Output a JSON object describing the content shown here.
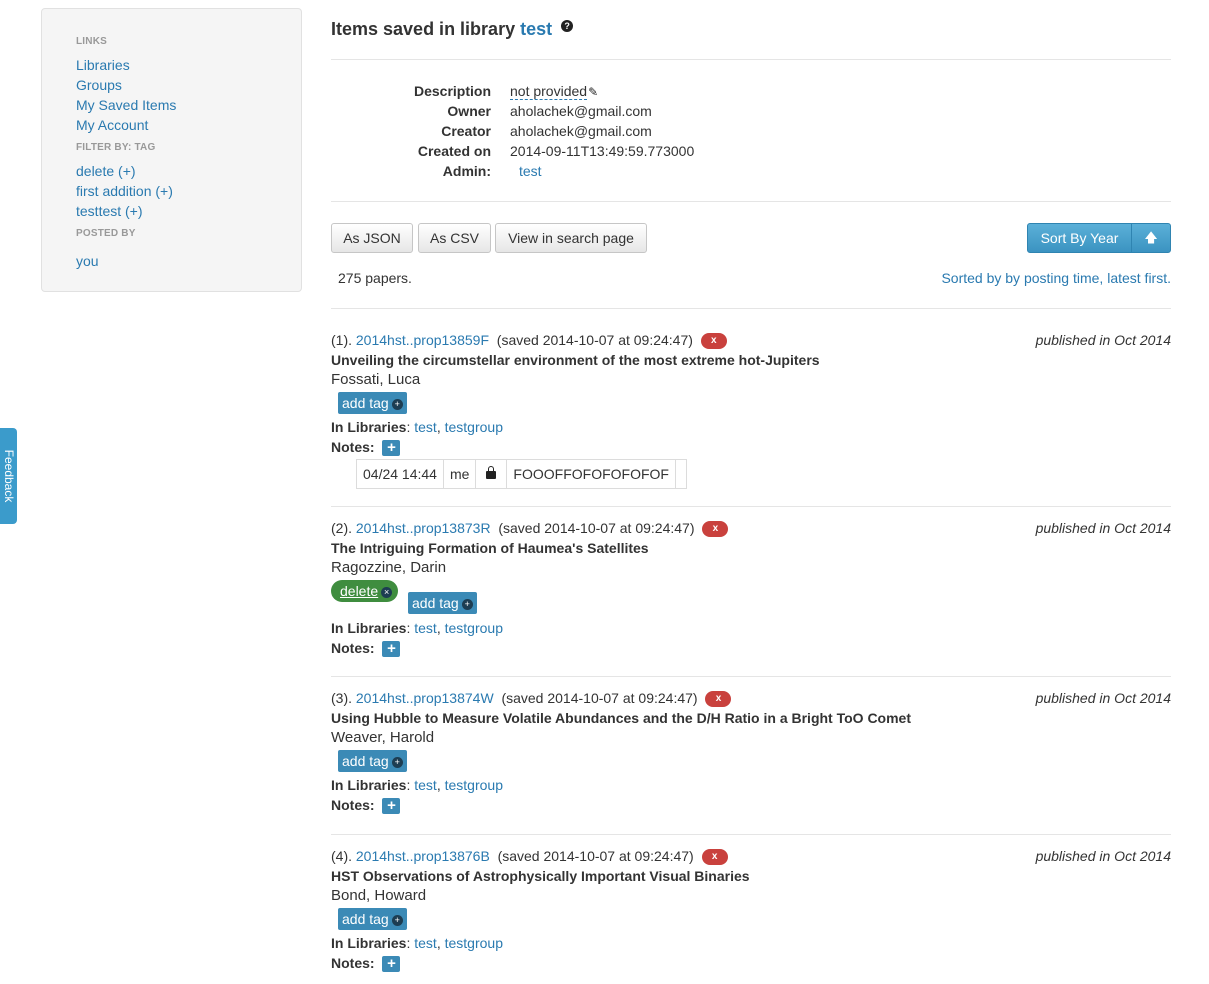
{
  "sidebar": {
    "links_heading": "LINKS",
    "links": [
      "Libraries",
      "Groups",
      "My Saved Items",
      "My Account"
    ],
    "filter_heading": "FILTER BY: TAG",
    "tags": [
      "delete (+)",
      "first addition (+)",
      "testtest (+)"
    ],
    "posted_heading": "POSTED BY",
    "posted_by": "you"
  },
  "feedback": "Feedback",
  "header": {
    "title_prefix": "Items saved in library",
    "library_name": "test",
    "help_glyph": "?"
  },
  "meta": {
    "description_label": "Description",
    "description_value": "not provided",
    "owner_label": "Owner",
    "owner_value": "aholachek@gmail.com",
    "creator_label": "Creator",
    "creator_value": "aholachek@gmail.com",
    "created_label": "Created on",
    "created_value": "2014-09-11T13:49:59.773000",
    "admin_label": "Admin:",
    "admin_value": "test"
  },
  "toolbar": {
    "json_label": "As JSON",
    "csv_label": "As CSV",
    "search_label": "View in search page",
    "sort_label": "Sort By Year",
    "sort_dir_glyph": "🡅"
  },
  "summary": {
    "count": "275 papers.",
    "sorted": "Sorted by by posting time, latest first."
  },
  "labels": {
    "in_libraries": "In Libraries",
    "notes": "Notes:",
    "add_tag": "add tag",
    "remove_glyph": "x",
    "plus_glyph": "+"
  },
  "entries": [
    {
      "index": "(1).",
      "bibcode": "2014hst..prop13859F",
      "saved": "(saved 2014-10-07 at 09:24:47)",
      "published": "published in Oct 2014",
      "title": "Unveiling the circumstellar environment of the most extreme hot-Jupiters",
      "author": "Fossati, Luca",
      "lib1": "test",
      "lib2": "testgroup",
      "note": {
        "time": "04/24 14:44",
        "who": "me",
        "text": "FOOOFFOFOFOFOFOF"
      }
    },
    {
      "index": "(2).",
      "bibcode": "2014hst..prop13873R",
      "saved": "(saved 2014-10-07 at 09:24:47)",
      "published": "published in Oct 2014",
      "title": "The Intriguing Formation of Haumea's Satellites",
      "author": "Ragozzine, Darin",
      "tag": "delete",
      "lib1": "test",
      "lib2": "testgroup"
    },
    {
      "index": "(3).",
      "bibcode": "2014hst..prop13874W",
      "saved": "(saved 2014-10-07 at 09:24:47)",
      "published": "published in Oct 2014",
      "title": "Using Hubble to Measure Volatile Abundances and the D/H Ratio in a Bright ToO Comet",
      "author": "Weaver, Harold",
      "lib1": "test",
      "lib2": "testgroup"
    },
    {
      "index": "(4).",
      "bibcode": "2014hst..prop13876B",
      "saved": "(saved 2014-10-07 at 09:24:47)",
      "published": "published in Oct 2014",
      "title": "HST Observations of Astrophysically Important Visual Binaries",
      "author": "Bond, Howard",
      "lib1": "test",
      "lib2": "testgroup"
    }
  ]
}
